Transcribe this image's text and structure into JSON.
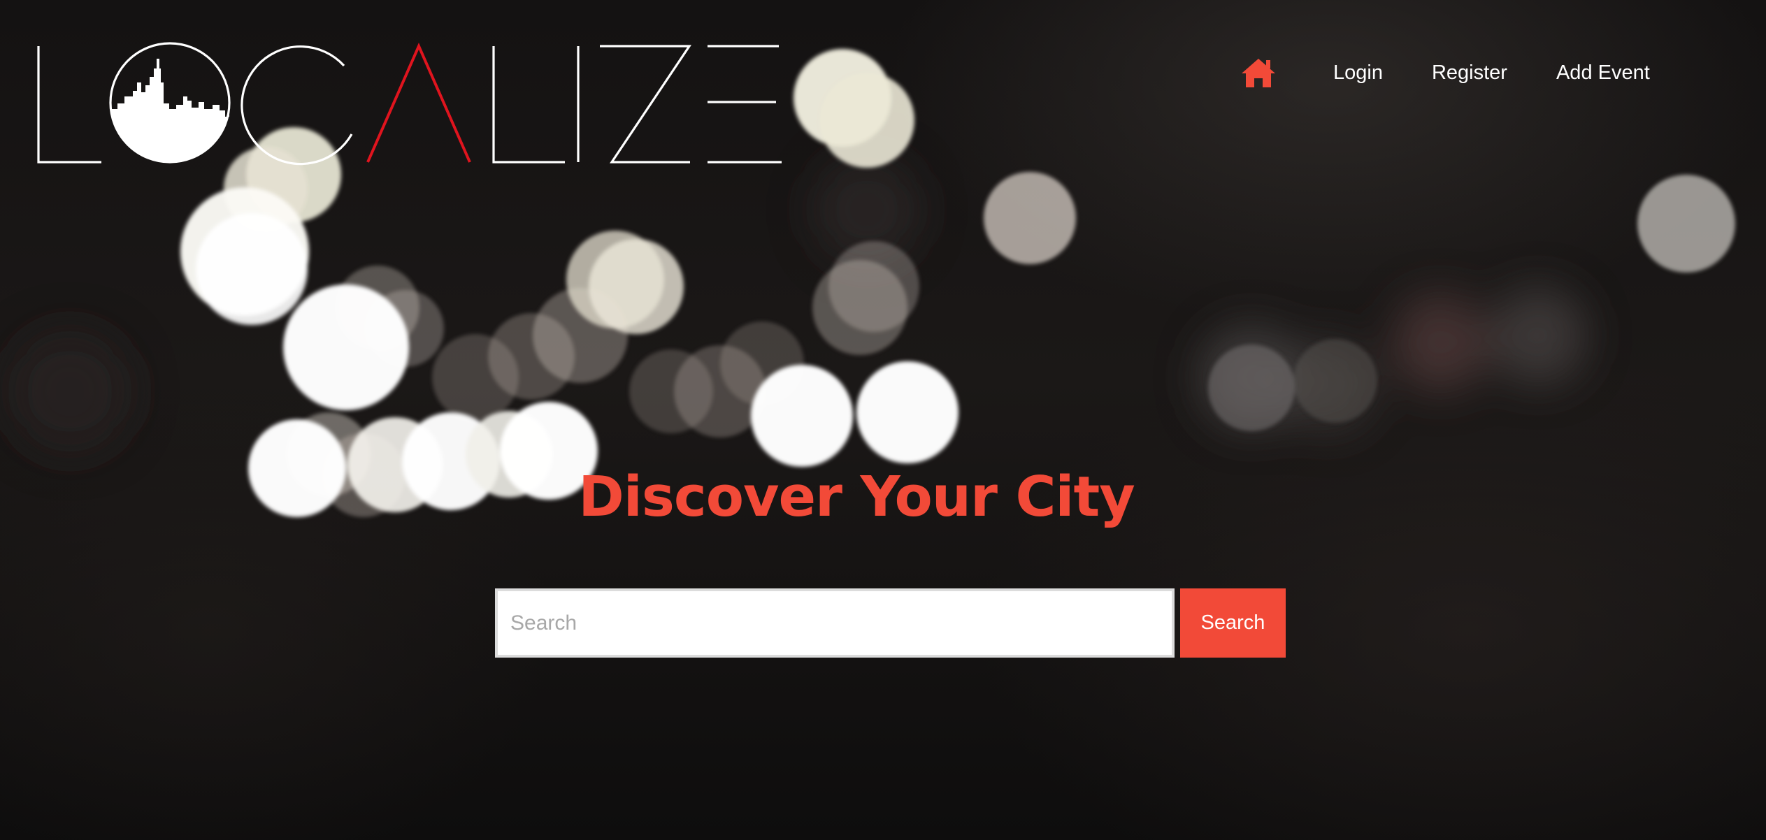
{
  "brand": {
    "logo_text": "LOCALIZE",
    "text_color": "#ffffff",
    "accent_letter_color": "#e0141e"
  },
  "nav": {
    "home_icon": "home-icon",
    "home_color": "#f24a38",
    "links": [
      {
        "label": "Login"
      },
      {
        "label": "Register"
      },
      {
        "label": "Add Event"
      }
    ]
  },
  "hero": {
    "headline": "Discover Your City",
    "headline_color": "#f24a38"
  },
  "search": {
    "placeholder": "Search",
    "value": "",
    "button_label": "Search",
    "button_color": "#f24a38"
  }
}
